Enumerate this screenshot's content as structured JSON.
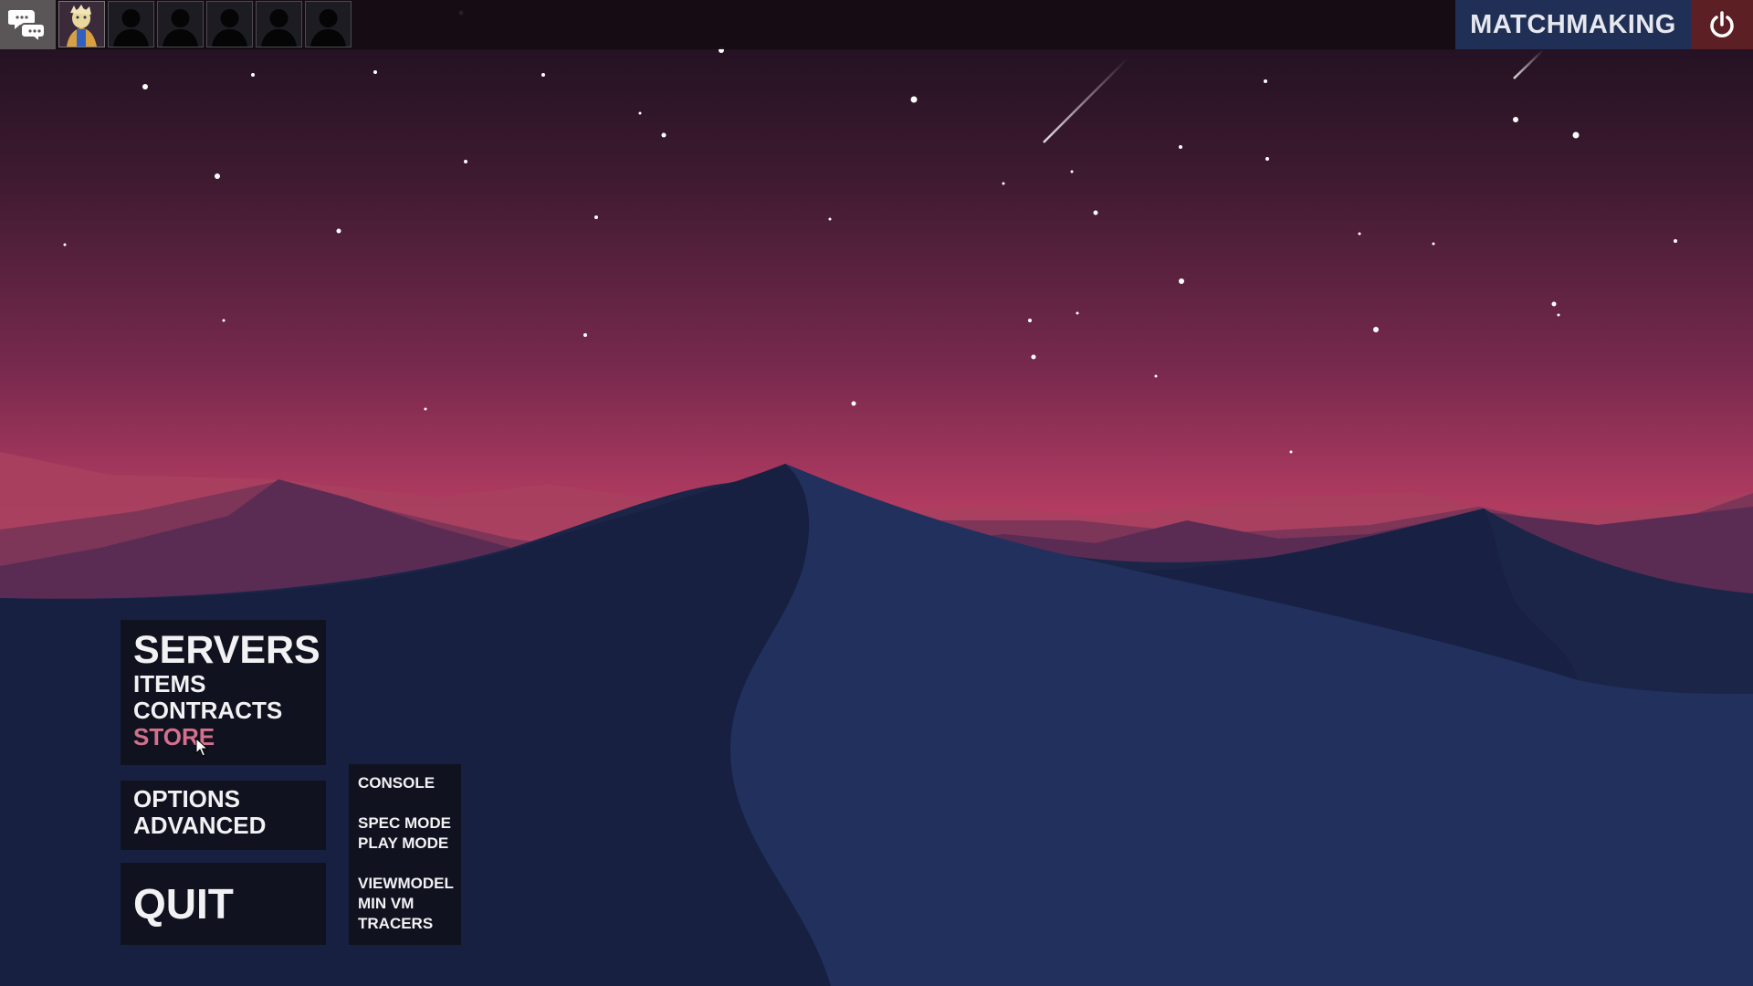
{
  "topbar": {
    "chat_icon": "chat-bubbles-icon",
    "party_slots": [
      {
        "type": "player-avatar"
      },
      {
        "type": "empty-silhouette"
      },
      {
        "type": "empty-silhouette"
      },
      {
        "type": "empty-silhouette"
      },
      {
        "type": "empty-silhouette"
      },
      {
        "type": "empty-silhouette"
      }
    ],
    "matchmaking_label": "MATCHMAKING",
    "power_icon": "power-icon"
  },
  "menu": {
    "main": [
      "SERVERS",
      "ITEMS",
      "CONTRACTS",
      "STORE"
    ],
    "hovered": "STORE",
    "options": [
      "OPTIONS",
      "ADVANCED"
    ],
    "quit": "QUIT",
    "advanced_group1": [
      "CONSOLE"
    ],
    "advanced_group2": [
      "SPEC MODE",
      "PLAY MODE"
    ],
    "advanced_group3": [
      "VIEWMODEL",
      "MIN VM",
      "TRACERS"
    ]
  },
  "colors": {
    "sky_top": "#1a0f1e",
    "sky_bottom": "#d44d70",
    "dune_dark": "#172243",
    "dune_light": "#22305c",
    "highlight": "#d4708c",
    "matchmaking_bg": "#1f2f55",
    "power_bg": "#5c1f24"
  }
}
